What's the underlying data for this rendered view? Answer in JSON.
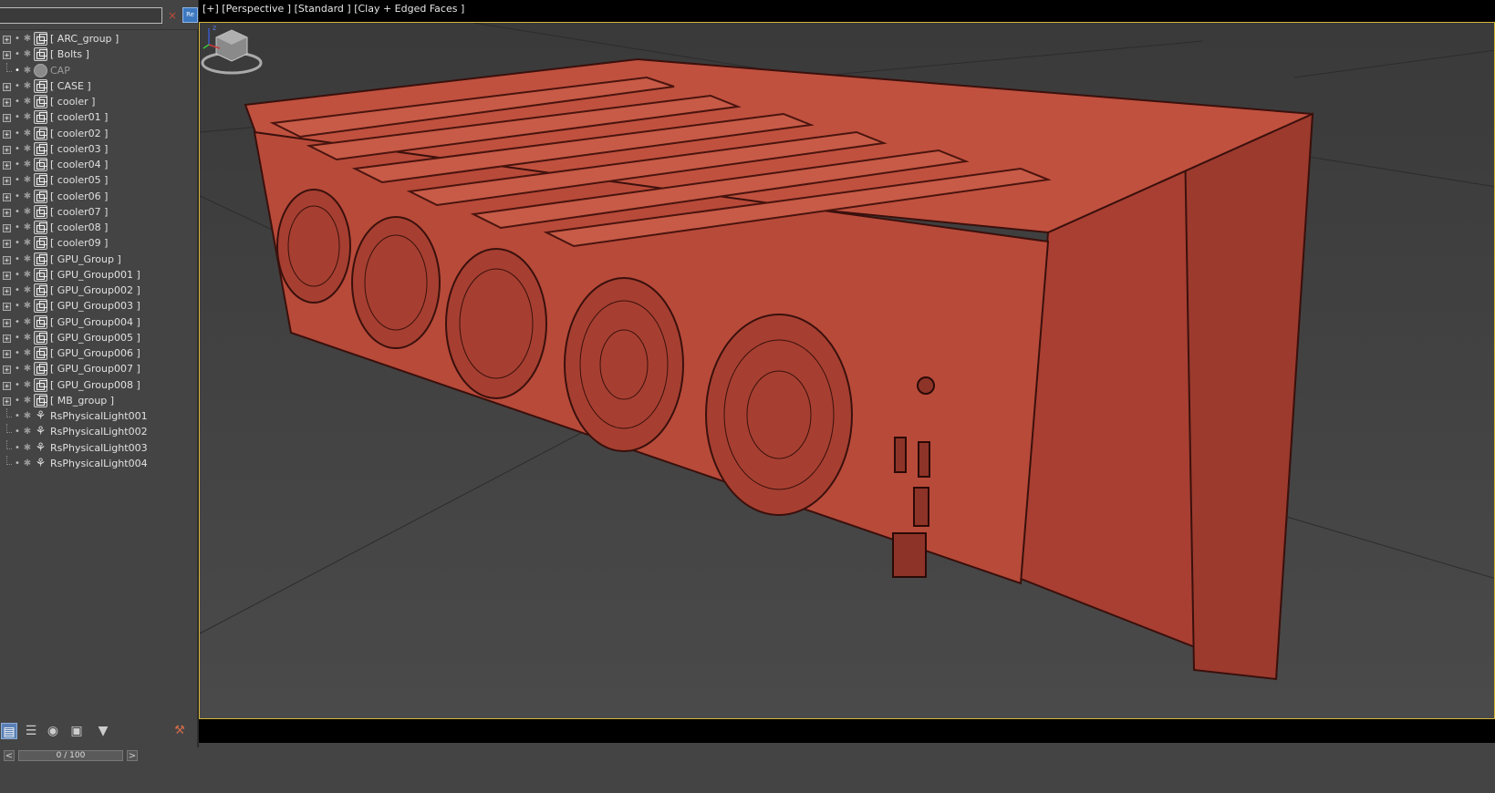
{
  "explorer": {
    "search": {
      "value": "",
      "placeholder": ""
    },
    "clear_icon": "×",
    "regex_label": "Re",
    "items": [
      {
        "label": "[ ARC_group ]",
        "type": "group",
        "expandable": true,
        "visible": true
      },
      {
        "label": "[ Bolts ]",
        "type": "group",
        "expandable": true,
        "visible": true
      },
      {
        "label": "CAP",
        "type": "sphere",
        "expandable": false,
        "visible": true,
        "dim": true
      },
      {
        "label": "[ CASE ]",
        "type": "group",
        "expandable": true,
        "visible": true
      },
      {
        "label": "[ cooler ]",
        "type": "group",
        "expandable": true,
        "visible": true
      },
      {
        "label": "[ cooler01 ]",
        "type": "group",
        "expandable": true,
        "visible": true
      },
      {
        "label": "[ cooler02 ]",
        "type": "group",
        "expandable": true,
        "visible": true
      },
      {
        "label": "[ cooler03 ]",
        "type": "group",
        "expandable": true,
        "visible": true
      },
      {
        "label": "[ cooler04 ]",
        "type": "group",
        "expandable": true,
        "visible": true
      },
      {
        "label": "[ cooler05 ]",
        "type": "group",
        "expandable": true,
        "visible": true
      },
      {
        "label": "[ cooler06 ]",
        "type": "group",
        "expandable": true,
        "visible": true
      },
      {
        "label": "[ cooler07 ]",
        "type": "group",
        "expandable": true,
        "visible": true
      },
      {
        "label": "[ cooler08 ]",
        "type": "group",
        "expandable": true,
        "visible": true
      },
      {
        "label": "[ cooler09 ]",
        "type": "group",
        "expandable": true,
        "visible": true
      },
      {
        "label": "[ GPU_Group ]",
        "type": "group",
        "expandable": true,
        "visible": true
      },
      {
        "label": "[ GPU_Group001 ]",
        "type": "group",
        "expandable": true,
        "visible": true
      },
      {
        "label": "[ GPU_Group002 ]",
        "type": "group",
        "expandable": true,
        "visible": true
      },
      {
        "label": "[ GPU_Group003 ]",
        "type": "group",
        "expandable": true,
        "visible": true
      },
      {
        "label": "[ GPU_Group004 ]",
        "type": "group",
        "expandable": true,
        "visible": true
      },
      {
        "label": "[ GPU_Group005 ]",
        "type": "group",
        "expandable": true,
        "visible": true
      },
      {
        "label": "[ GPU_Group006 ]",
        "type": "group",
        "expandable": true,
        "visible": true
      },
      {
        "label": "[ GPU_Group007 ]",
        "type": "group",
        "expandable": true,
        "visible": true
      },
      {
        "label": "[ GPU_Group008 ]",
        "type": "group",
        "expandable": true,
        "visible": true
      },
      {
        "label": "[ MB_group ]",
        "type": "group",
        "expandable": true,
        "visible": true
      },
      {
        "label": "RsPhysicalLight001",
        "type": "light",
        "expandable": false,
        "visible": true
      },
      {
        "label": "RsPhysicalLight002",
        "type": "light",
        "expandable": false,
        "visible": true
      },
      {
        "label": "RsPhysicalLight003",
        "type": "light",
        "expandable": false,
        "visible": true
      },
      {
        "label": "RsPhysicalLight004",
        "type": "light",
        "expandable": false,
        "visible": true
      }
    ],
    "toolbar": [
      {
        "icon": "hierarchy-icon",
        "active": true
      },
      {
        "icon": "layers-icon",
        "active": false
      },
      {
        "icon": "material-icon",
        "active": false
      },
      {
        "icon": "display-icon",
        "active": false
      },
      {
        "icon": "filter-icon",
        "active": false
      }
    ]
  },
  "timeslider": {
    "value": "0 / 100",
    "prev": "<",
    "next": ">"
  },
  "viewport": {
    "label": "[+] [Perspective ] [Standard ] [Clay + Edged Faces ]",
    "model_color": "#b94a3a",
    "border_color": "#d4b63a"
  },
  "gizmo": {
    "z_label": "z"
  }
}
